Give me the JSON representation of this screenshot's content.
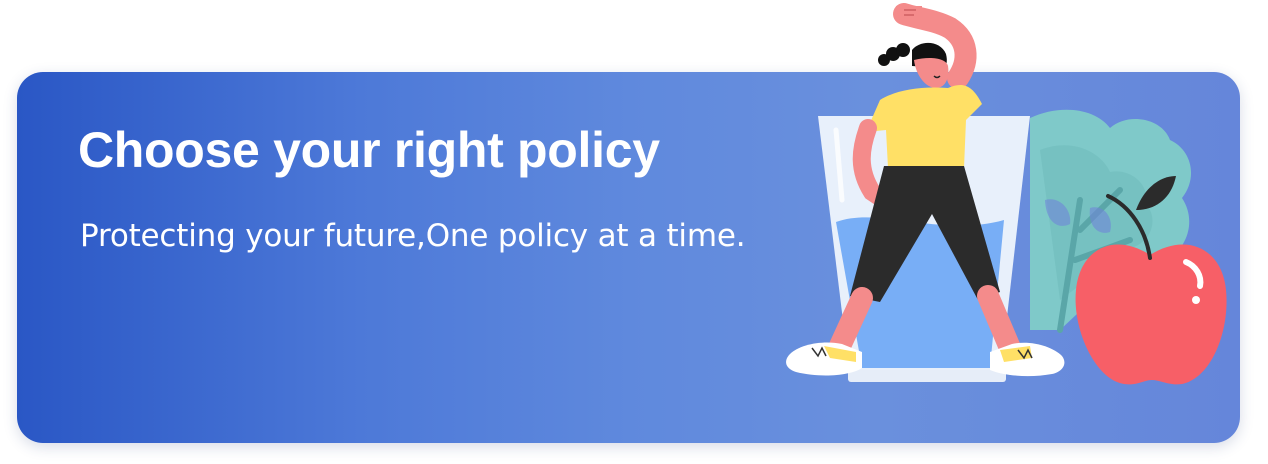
{
  "banner": {
    "title": "Choose your right policy",
    "subtitle": "Protecting your future,One policy at a time."
  },
  "illustration": {
    "name": "exercise-illustration",
    "elements": [
      "person-icon",
      "water-glass-icon",
      "leaf-plant-icon",
      "apple-icon"
    ]
  },
  "colors": {
    "gradient_start": "#2a57c5",
    "gradient_end": "#6586da",
    "text": "#ffffff",
    "shirt": "#ffe066",
    "pants": "#2b2b2b",
    "skin": "#f48b8b",
    "apple": "#f75f67",
    "plant": "#7fc9c9",
    "glass": "#e8f0fb",
    "water": "#78aef6"
  }
}
